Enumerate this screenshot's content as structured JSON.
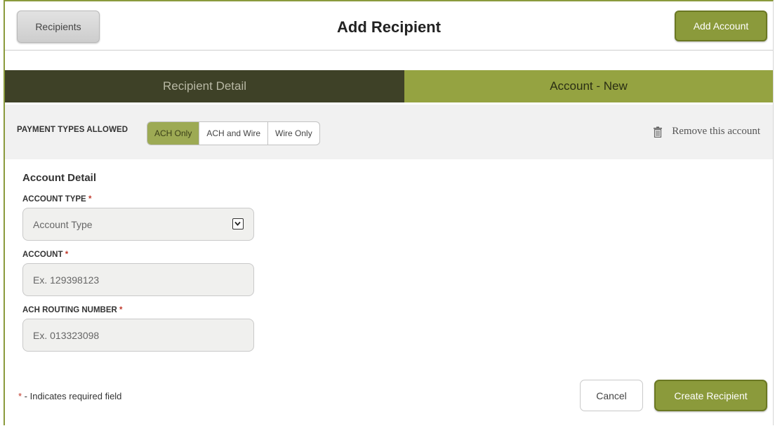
{
  "header": {
    "back_label": "Recipients",
    "title": "Add Recipient",
    "add_account_label": "Add Account"
  },
  "tabs": [
    {
      "label": "Recipient Detail",
      "active": false
    },
    {
      "label": "Account - New",
      "active": true
    }
  ],
  "payment_types": {
    "label": "PAYMENT TYPES ALLOWED",
    "options": [
      "ACH Only",
      "ACH and Wire",
      "Wire Only"
    ],
    "selected": "ACH Only"
  },
  "remove_label": "Remove this account",
  "account_detail": {
    "title": "Account Detail",
    "account_type": {
      "label": "ACCOUNT TYPE",
      "required_mark": "*",
      "value": "Account Type",
      "icon": "chevron-down-icon"
    },
    "account": {
      "label": "ACCOUNT",
      "required_mark": "*",
      "placeholder": "Ex. 129398123"
    },
    "routing": {
      "label": "ACH ROUTING NUMBER",
      "required_mark": "*",
      "placeholder": "Ex. 013323098"
    }
  },
  "footer": {
    "required_mark": "*",
    "required_note": " - Indicates required field",
    "cancel_label": "Cancel",
    "create_label": "Create Recipient"
  },
  "colors": {
    "accent": "#8b9a3b",
    "tab_dark": "#3e4127",
    "tab_active": "#95a341",
    "required": "#c0392b"
  }
}
